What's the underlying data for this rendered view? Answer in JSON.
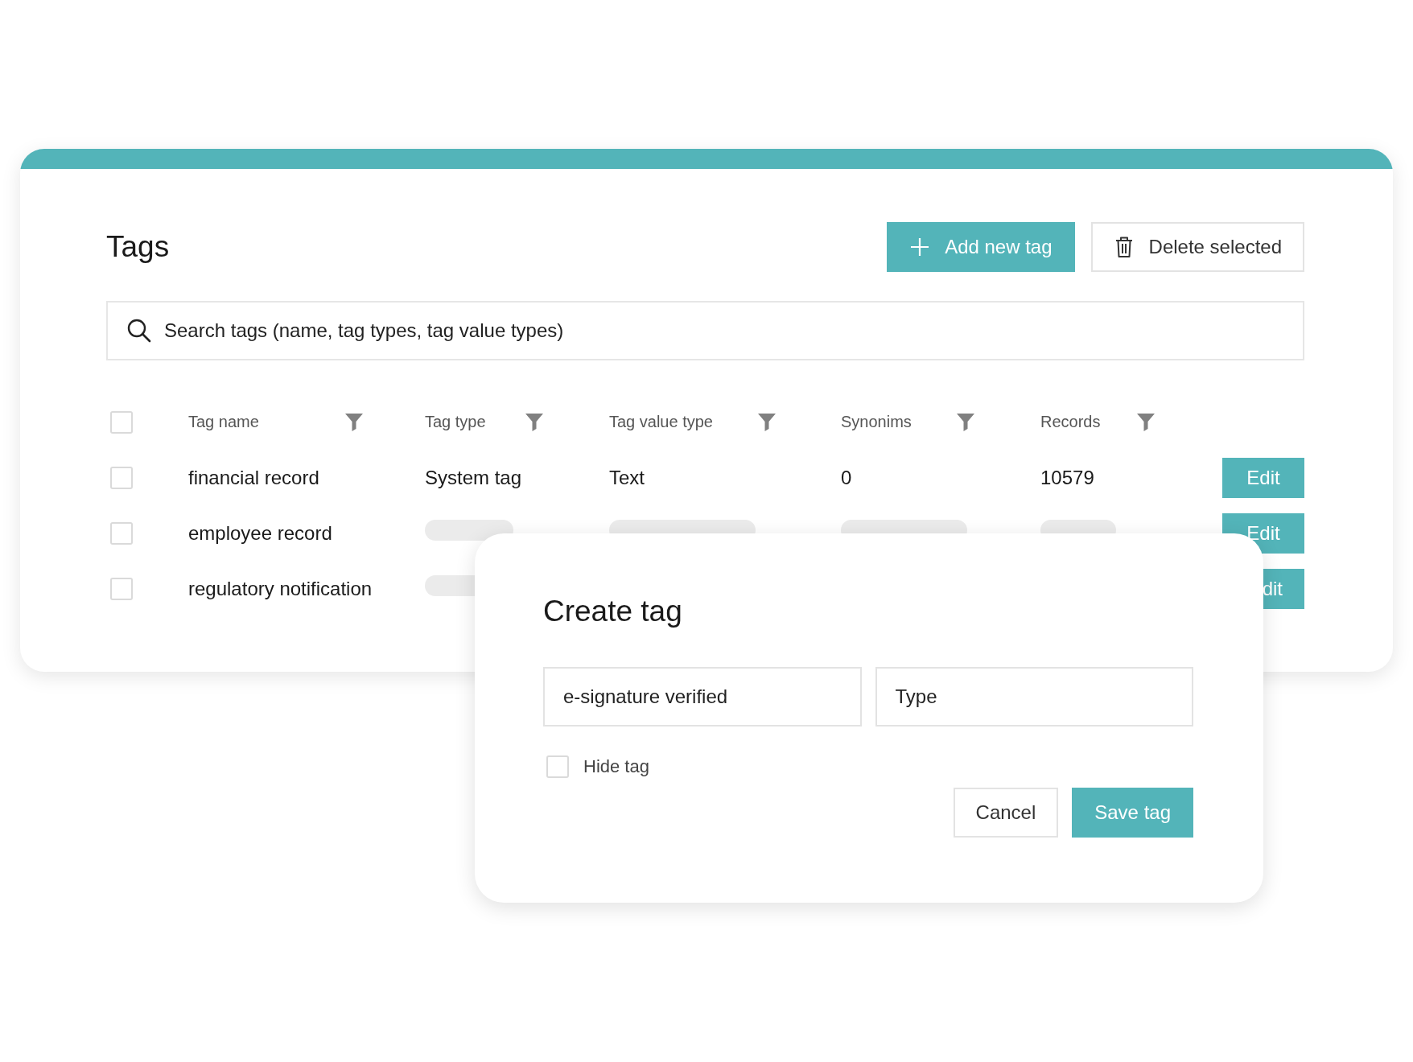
{
  "card": {
    "title": "Tags",
    "buttons": [
      {
        "kind": "primary",
        "label": "Add new tag"
      },
      {
        "kind": "secondary",
        "label": "Delete selected"
      }
    ],
    "search": {
      "placeholder": "Search tags (name, tag types, tag value types)"
    }
  },
  "table": {
    "select_all": {
      "checked": false
    },
    "columns": [
      "Tag name",
      "Tag type",
      "Tag value type",
      "Synonims",
      "Records"
    ],
    "rows": [
      {
        "kind": "loaded",
        "checked": false,
        "cells": [
          "financial record",
          "System tag",
          "Text",
          "0",
          "10579"
        ],
        "action": "Edit"
      },
      {
        "kind": "loading",
        "checked": false,
        "cells": [
          "employee record"
        ],
        "action": "Edit"
      },
      {
        "kind": "loading",
        "checked": false,
        "cells": [
          "regulatory notification"
        ],
        "action": "dit"
      }
    ]
  },
  "dialog": {
    "title": "Create tag",
    "fields": [
      {
        "value": "e-signature verified"
      },
      {
        "placeholder": "Type"
      }
    ],
    "hide_tag": {
      "label": "Hide tag",
      "checked": false
    },
    "buttons": [
      {
        "kind": "secondary",
        "label": "Cancel"
      },
      {
        "kind": "primary",
        "label": "Save tag"
      }
    ]
  }
}
